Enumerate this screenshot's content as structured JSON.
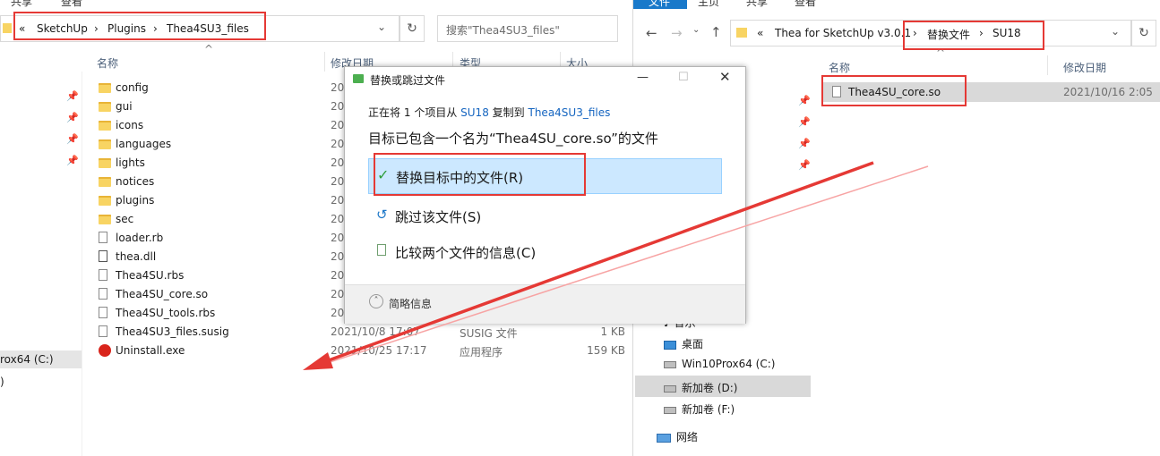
{
  "left_window": {
    "ribbon": [
      "共享",
      "查看"
    ],
    "address": [
      "«",
      "SketchUp",
      "Plugins",
      "Thea4SU3_files"
    ],
    "search_placeholder": "搜索\"Thea4SU3_files\"",
    "columns": {
      "name": "名称",
      "modified": "修改日期",
      "type": "类型",
      "size": "大小"
    },
    "files": [
      {
        "name": "config",
        "kind": "folder",
        "date": "20"
      },
      {
        "name": "gui",
        "kind": "folder",
        "date": "20"
      },
      {
        "name": "icons",
        "kind": "folder",
        "date": "20"
      },
      {
        "name": "languages",
        "kind": "folder",
        "date": "20"
      },
      {
        "name": "lights",
        "kind": "folder",
        "date": "20"
      },
      {
        "name": "notices",
        "kind": "folder",
        "date": "20"
      },
      {
        "name": "plugins",
        "kind": "folder",
        "date": "20"
      },
      {
        "name": "sec",
        "kind": "folder",
        "date": "20"
      },
      {
        "name": "loader.rb",
        "kind": "file",
        "date": "20"
      },
      {
        "name": "thea.dll",
        "kind": "dll",
        "date": "20"
      },
      {
        "name": "Thea4SU.rbs",
        "kind": "file",
        "date": "20"
      },
      {
        "name": "Thea4SU_core.so",
        "kind": "file",
        "date": "20"
      },
      {
        "name": "Thea4SU_tools.rbs",
        "kind": "file",
        "date": "20"
      },
      {
        "name": "Thea4SU3_files.susig",
        "kind": "file",
        "date": "2021/10/8 17:07",
        "type": "SUSIG 文件",
        "size": "1 KB"
      },
      {
        "name": "Uninstall.exe",
        "kind": "exe",
        "date": "2021/10/25 17:17",
        "type": "应用程序",
        "size": "159 KB"
      }
    ],
    "nav_partial": [
      "rox64 (C:)",
      ")"
    ]
  },
  "right_window": {
    "ribbon": [
      "文件",
      "主页",
      "共享",
      "查看"
    ],
    "address": [
      "«",
      "Thea for SketchUp v3.0.1",
      "替换文件",
      "SU18"
    ],
    "columns": {
      "name": "名称",
      "modified": "修改日期"
    },
    "files": [
      {
        "name": "Thea4SU_core.so",
        "date": "2021/10/16 2:05"
      }
    ],
    "nav": [
      {
        "label": "音乐",
        "icon": "music-icon"
      },
      {
        "label": "桌面",
        "icon": "desktop-icon"
      },
      {
        "label": "Win10Prox64 (C:)",
        "icon": "drive-icon"
      },
      {
        "label": "新加卷 (D:)",
        "icon": "drive-icon",
        "selected": true
      },
      {
        "label": "新加卷 (F:)",
        "icon": "drive-icon"
      },
      {
        "label": "网络",
        "icon": "network-icon"
      }
    ]
  },
  "dialog": {
    "title": "替换或跳过文件",
    "progress_prefix": "正在将",
    "count": "1",
    "progress_mid": "个项目从",
    "source": "SU18",
    "progress_mid2": "复制到",
    "dest": "Thea4SU3_files",
    "heading": "目标已包含一个名为“Thea4SU_core.so”的文件",
    "options": [
      "替换目标中的文件(R)",
      "跳过该文件(S)",
      "比较两个文件的信息(C)"
    ],
    "details": "简略信息"
  },
  "colors": {
    "accent": "#1979ca",
    "highlight": "#cce8ff",
    "annotation": "#e53935"
  }
}
